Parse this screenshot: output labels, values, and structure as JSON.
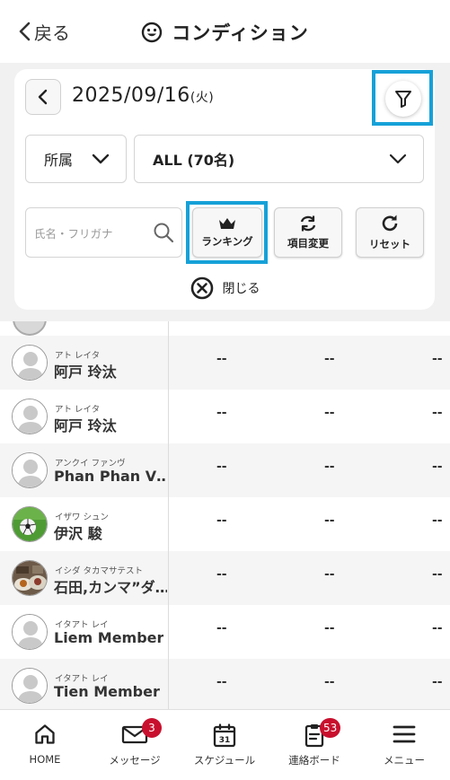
{
  "header": {
    "back_label": "戻る",
    "title": "コンディション"
  },
  "filter": {
    "date": "2025/09/16",
    "weekday": "(火)",
    "affiliation_label": "所属",
    "group_label": "ALL (70名)",
    "search_placeholder": "氏名・フリガナ",
    "ranking_label": "ランキング",
    "items_label": "項目変更",
    "reset_label": "リセット",
    "close_label": "閉じる"
  },
  "members": [
    {
      "kana": "アト レイタ",
      "name": "阿戸 玲汰",
      "avatar": "default-avatar",
      "values": [
        "--",
        "--",
        "--"
      ]
    },
    {
      "kana": "アト レイタ",
      "name": "阿戸 玲汰",
      "avatar": "default-avatar",
      "values": [
        "--",
        "--",
        "--"
      ]
    },
    {
      "kana": "アンクイ ファンヴ",
      "name": "Phan Phan V…",
      "avatar": "default-avatar",
      "values": [
        "--",
        "--",
        "--"
      ]
    },
    {
      "kana": "イザワ シュン",
      "name": "伊沢 駿",
      "avatar": "soccer-ball-photo",
      "values": [
        "--",
        "--",
        "--"
      ]
    },
    {
      "kana": "イシダ タカマサテスト",
      "name": "石田,カンマ”ダ…",
      "avatar": "food-photo",
      "values": [
        "--",
        "--",
        "--"
      ]
    },
    {
      "kana": "イタアト レイ",
      "name": "Liem Member",
      "avatar": "default-avatar",
      "values": [
        "--",
        "--",
        "--"
      ]
    },
    {
      "kana": "イタアト レイ",
      "name": "Tien Member",
      "avatar": "default-avatar",
      "values": [
        "--",
        "--",
        "--"
      ]
    }
  ],
  "nav": {
    "home": "HOME",
    "message": "メッセージ",
    "message_badge": "3",
    "schedule": "スケジュール",
    "schedule_day": "31",
    "board": "連絡ボード",
    "board_badge": "53",
    "menu": "メニュー"
  },
  "colors": {
    "highlight": "#16a1d8",
    "badge": "#c8102e"
  }
}
